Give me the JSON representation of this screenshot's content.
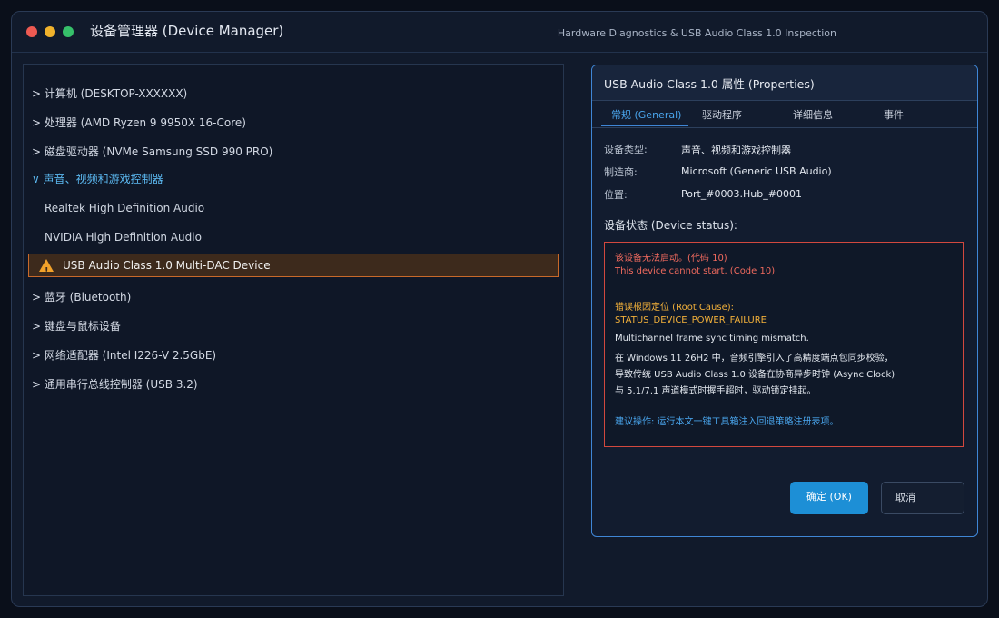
{
  "window": {
    "title": "设备管理器 (Device Manager)",
    "subtitle": "Hardware Diagnostics & USB Audio Class 1.0 Inspection"
  },
  "tree": {
    "items": [
      {
        "label": "> 计算机 (DESKTOP-XXXXXX)"
      },
      {
        "label": "> 处理器 (AMD Ryzen 9 9950X 16-Core)"
      },
      {
        "label": "> 磁盘驱动器 (NVMe Samsung SSD 990 PRO)"
      },
      {
        "label": "∨ 声音、视频和游戏控制器"
      },
      {
        "label": "Realtek High Definition Audio"
      },
      {
        "label": "NVIDIA High Definition Audio"
      },
      {
        "label": "USB Audio Class 1.0 Multi-DAC Device"
      },
      {
        "label": "> 蓝牙 (Bluetooth)"
      },
      {
        "label": "> 键盘与鼠标设备"
      },
      {
        "label": "> 网络适配器 (Intel I226-V 2.5GbE)"
      },
      {
        "label": "> 通用串行总线控制器 (USB 3.2)"
      }
    ],
    "selected_icon": "warning-icon"
  },
  "dialog": {
    "title": "USB Audio Class 1.0 属性 (Properties)",
    "tabs": [
      {
        "label": "常规 (General)"
      },
      {
        "label": "驱动程序"
      },
      {
        "label": "详细信息"
      },
      {
        "label": "事件"
      }
    ],
    "props": [
      {
        "label": "设备类型:",
        "value": "声音、视频和游戏控制器"
      },
      {
        "label": "制造商:",
        "value": "Microsoft (Generic USB Audio)"
      },
      {
        "label": "位置:",
        "value": "Port_#0003.Hub_#0001"
      }
    ],
    "status_heading": "设备状态 (Device status):",
    "status": {
      "error_cn": "该设备无法启动。(代码 10)",
      "error_en": "This device cannot start. (Code 10)",
      "cause_heading": "错误根因定位 (Root Cause):",
      "cause_code": "STATUS_DEVICE_POWER_FAILURE",
      "body": [
        "Multichannel frame sync timing mismatch.",
        "在 Windows 11 26H2 中，音频引擎引入了高精度端点包同步校验，",
        "导致传统 USB Audio Class 1.0 设备在协商异步时钟 (Async Clock)",
        "与 5.1/7.1 声道模式时握手超时，驱动锁定挂起。"
      ],
      "suggestion": "建议操作: 运行本文一键工具箱注入回退策略注册表项。"
    },
    "ok_label": "确定 (OK)",
    "cancel_label": "取消"
  },
  "colors": {
    "accent": "#3f86d6",
    "error": "#d2483e",
    "warning": "#f2a22a",
    "selection": "#c8692a"
  }
}
